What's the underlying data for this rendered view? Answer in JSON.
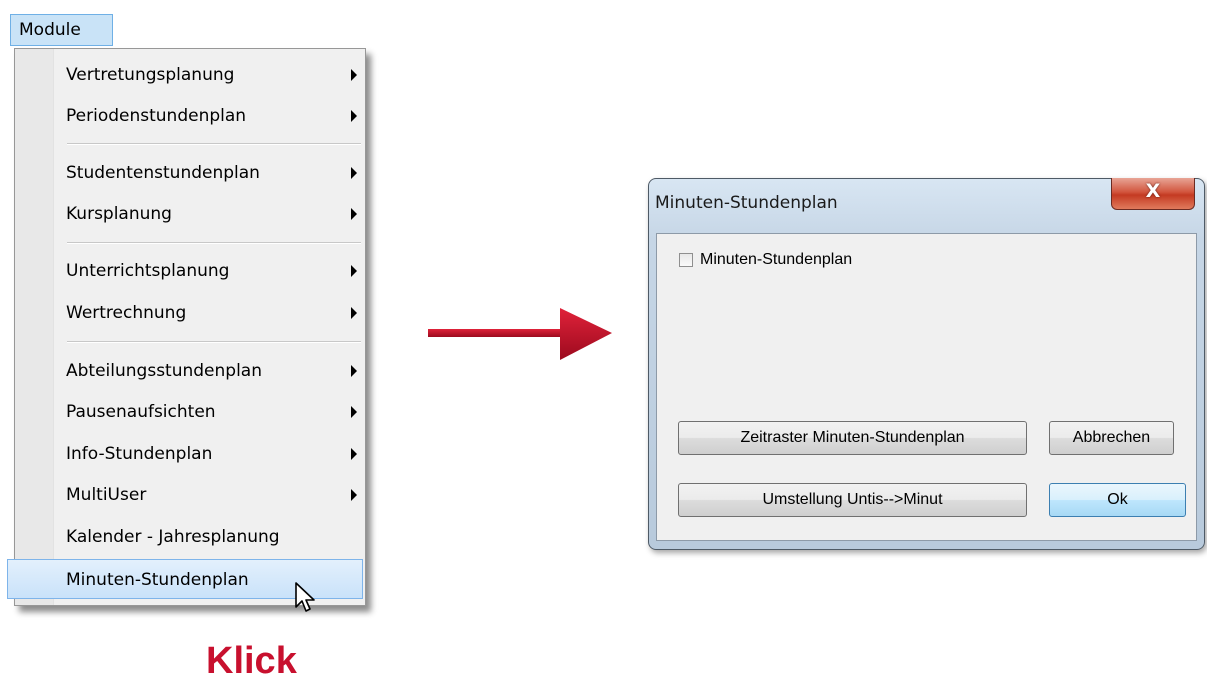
{
  "menubar": {
    "module_label": "Module"
  },
  "menu": {
    "items": [
      {
        "label": "Vertretungsplanung",
        "submenu": true
      },
      {
        "label": "Periodenstundenplan",
        "submenu": true
      },
      {
        "label": "Studentenstundenplan",
        "submenu": true
      },
      {
        "label": "Kursplanung",
        "submenu": true
      },
      {
        "label": "Unterrichtsplanung",
        "submenu": true
      },
      {
        "label": "Wertrechnung",
        "submenu": true
      },
      {
        "label": "Abteilungsstundenplan",
        "submenu": true
      },
      {
        "label": "Pausenaufsichten",
        "submenu": true
      },
      {
        "label": "Info-Stundenplan",
        "submenu": true
      },
      {
        "label": "MultiUser",
        "submenu": true
      },
      {
        "label": "Kalender - Jahresplanung",
        "submenu": false
      },
      {
        "label": "Minuten-Stundenplan",
        "submenu": false,
        "highlighted": true
      }
    ]
  },
  "annotation": {
    "klick_label": "Klick",
    "color": "#c8102e"
  },
  "dialog": {
    "title": "Minuten-Stundenplan",
    "close_label": "X",
    "checkbox_label": "Minuten-Stundenplan",
    "checkbox_checked": false,
    "buttons": {
      "zeitraster": "Zeitraster Minuten-Stundenplan",
      "abbrechen": "Abbrechen",
      "umstellung": "Umstellung Untis-->Minut",
      "ok": "Ok"
    }
  }
}
